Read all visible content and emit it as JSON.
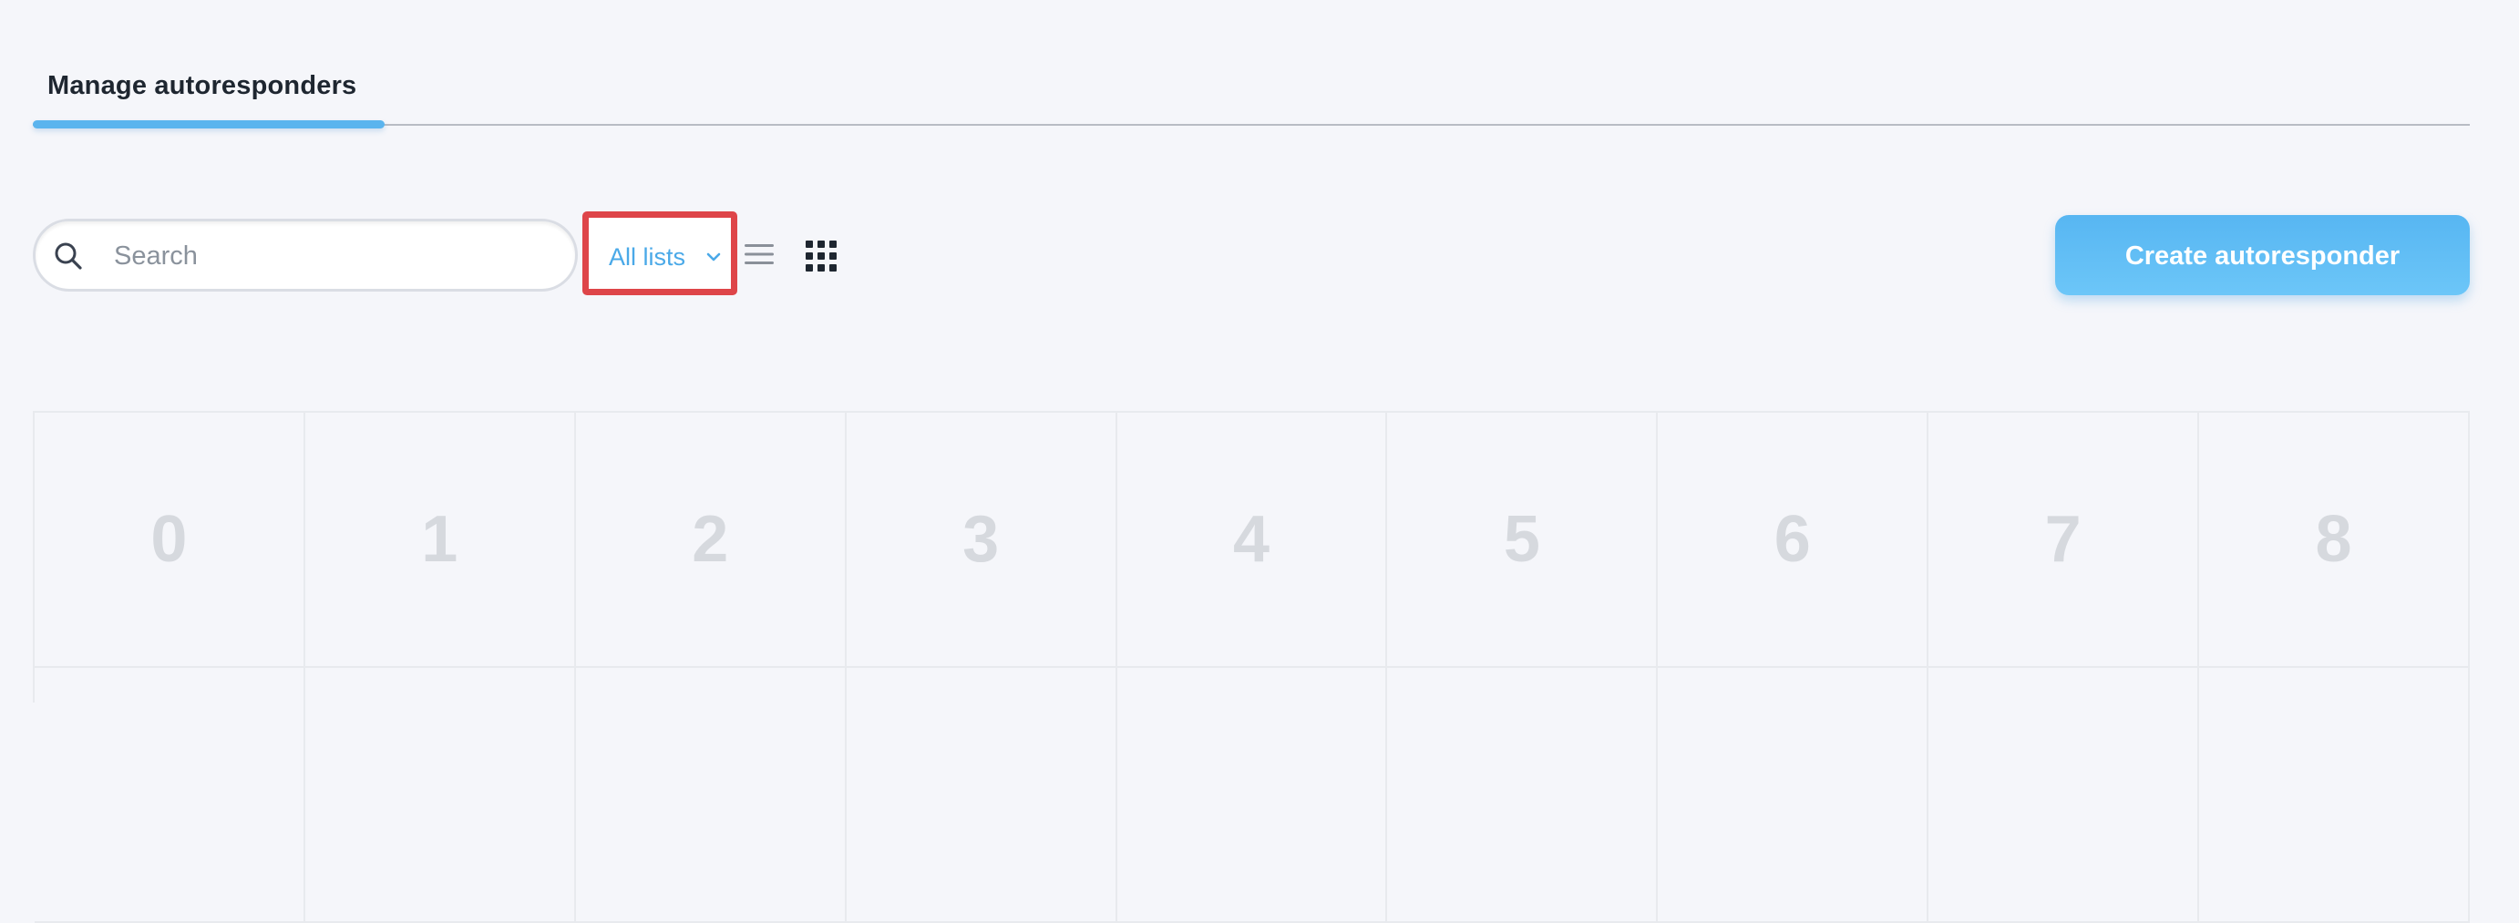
{
  "tabs": [
    {
      "label": "Manage autoresponders",
      "active": true
    }
  ],
  "toolbar": {
    "search_placeholder": "Search",
    "search_value": "",
    "filter_label": "All lists",
    "create_label": "Create autoresponder"
  },
  "icons": {
    "search": "search-icon",
    "filter_dropdown": "chevron-down-icon",
    "list_view": "list-view-icon",
    "grid_view": "grid-view-icon"
  },
  "grid": {
    "columns": [
      "0",
      "1",
      "2",
      "3",
      "4",
      "5",
      "6",
      "7",
      "8"
    ]
  },
  "colors": {
    "accent": "#5ab4ee",
    "highlight_border": "#de4549",
    "background": "#f5f6fa"
  }
}
